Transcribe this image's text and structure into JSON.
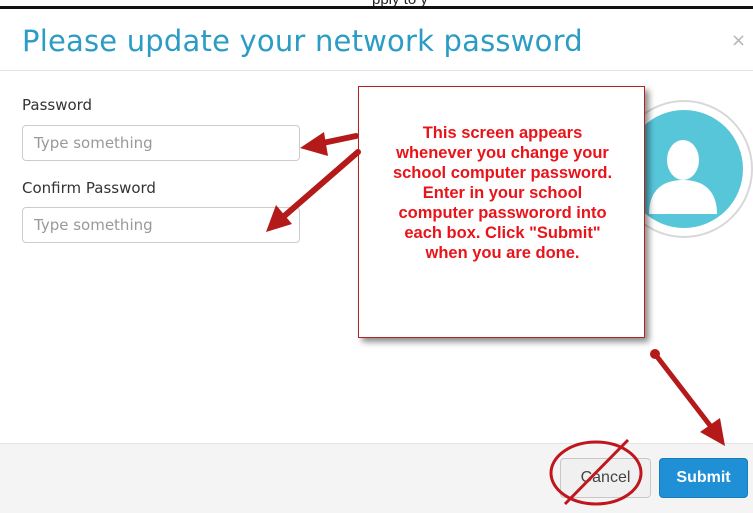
{
  "page": {
    "clipped_header_text": "pply to y"
  },
  "dialog": {
    "title": "Please update your network password",
    "close_label": "×"
  },
  "form": {
    "password": {
      "label": "Password",
      "placeholder": "Type something",
      "value": ""
    },
    "confirm_password": {
      "label": "Confirm Password",
      "placeholder": "Type something",
      "value": ""
    }
  },
  "annotation": {
    "callout_lines": [
      "This screen appears",
      "whenever you change your",
      "school computer password.",
      "Enter in your school",
      "computer passwor​ord into",
      "each box.  Click \"Submit\"",
      "when you are done."
    ],
    "arrow_color": "#b51a1a",
    "text_color": "#e8141a"
  },
  "footer": {
    "cancel_label": "Cancel",
    "submit_label": "Submit"
  },
  "colors": {
    "title": "#2b9cc4",
    "submit_bg": "#1f8fd6",
    "avatar": "#58c6d9"
  }
}
